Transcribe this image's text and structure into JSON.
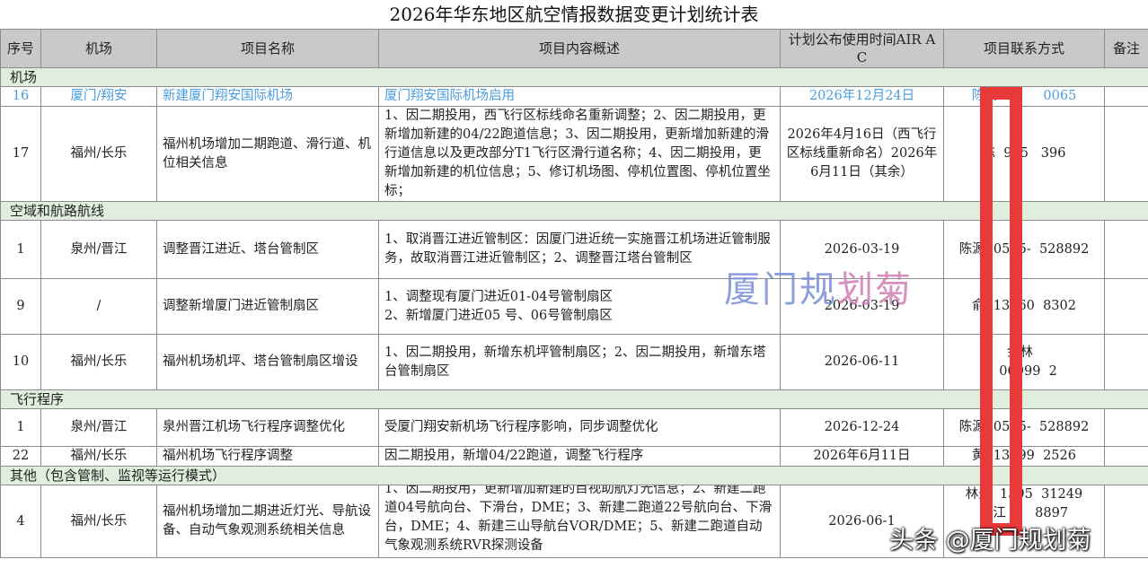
{
  "title": "2026年华东地区航空情报数据变更计划统计表",
  "headers": {
    "seq": "序号",
    "airport": "机场",
    "project": "项目名称",
    "summary": "项目内容概述",
    "publish_time": "计划公布使用时间AIR AC",
    "contact": "项目联系方式",
    "remark": "备注"
  },
  "sections": {
    "airport": "机场",
    "airspace": "空域和航路航线",
    "procedure": "飞行程序",
    "other": "其他（包含管制、监视等运行模式）"
  },
  "rows": {
    "airport_16": {
      "seq": "16",
      "airport": "厦门/翔安",
      "project": "新建厦门翔安国际机场",
      "summary": "厦门翔安国际机场启用",
      "time": "2026年12月24日",
      "contact": "陈精           0065"
    },
    "airport_17": {
      "seq": "17",
      "airport": "福州/长乐",
      "project": "福州机场增加二期跑道、滑行道、机位相关信息",
      "summary": "1、因二期投用，西飞行区标线命名重新调整；2、因二期投用，更新增加新建的04/22跑道信息；3、因二期投用，更新增加新建的滑行道信息以及更改部分T1飞行区滑行道名称；4、因二期投用，更新增加新建的机位信息；5、修订机场图、停机位置图、停机位置坐标；",
      "time": "2026年4月16日（西飞行区标线重新命名）2026年6月11日（其余）",
      "contact": "陈  995   396"
    },
    "airspace_1": {
      "seq": "1",
      "airport": "泉州/晋江",
      "project": "调整晋江进近、塔台管制区",
      "summary": "1、取消晋江进近管制区：因厦门进近统一实施晋江机场进近管制服务，故取消晋江进近管制区；2、调整晋江塔台管制区",
      "time": "2026-03-19",
      "contact": "陈源  0595-  528892"
    },
    "airspace_9": {
      "seq": "9",
      "airport": "/",
      "project": "调整新增厦门进近管制扇区",
      "summary": "1、调整现有厦门进近01-04号管制扇区\n2、新增厦门进近05 号、06号管制扇区",
      "time": "2026-03-19",
      "contact": "俞  13860  8302"
    },
    "airspace_10": {
      "seq": "10",
      "airport": "福州/长乐",
      "project": "福州机场机坪、塔台管制扇区增设",
      "summary": "1、因二期投用，新增东机坪管制扇区；2、因二期投用，新增东塔台管制扇区",
      "time": "2026-06-11",
      "contact": "金林  \n  06999  2"
    },
    "procedure_1": {
      "seq": "1",
      "airport": "泉州/晋江",
      "project": "泉州晋江机场飞行程序调整优化",
      "summary": "受厦门翔安新机场飞行程序影响，同步调整优化",
      "time": "2026-12-24",
      "contact": "陈源  0595-  528892"
    },
    "procedure_22": {
      "seq": "22",
      "airport": "福州/长乐",
      "project": "福州机场飞行程序调整",
      "summary": "因二期投用，新增04/22跑道，调整飞行程序",
      "time": "2026年6月11日",
      "contact": "黄  13599  2526"
    },
    "other_4": {
      "seq": "4",
      "airport": "福州/长乐",
      "project": "福州机场增加二期进近灯光、导航设备、自动气象观测系统相关信息",
      "summary": "1、因二期投用，更新增加新建的目视助航灯光信息；2、新建二跑道04号航向台、下滑台，DME；3、新建二跑道22号航向台、下滑台，DME；4、新建三山导航台VOR/DME；5、新建二跑道自动气象观测系统RVR探测设备",
      "time": "2026-06-1",
      "contact": "林圣  1395  31249\n丁江       8897"
    }
  },
  "watermarks": {
    "center_part1": "厦门规",
    "center_part2": "划菊",
    "corner": "头条 @厦门规划菊"
  },
  "colors": {
    "header_bg": "#c9c9c9",
    "section_bg": "#dfeedd",
    "link_text": "#4a9ce0",
    "redaction_bar": "#e83a3a"
  }
}
